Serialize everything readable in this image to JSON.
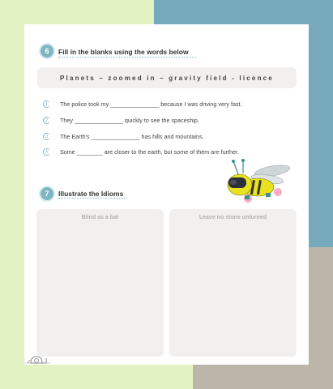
{
  "q6": {
    "number": "6",
    "title": "Fill in the blanks using the words below",
    "word_bank": "Planets – zoomed in – gravity field - licence",
    "sentences": [
      {
        "num": "1",
        "text": "The police took my _______________ because I was driving very fast."
      },
      {
        "num": "2",
        "text": "They _______________ quickly to see the spaceship."
      },
      {
        "num": "3",
        "text": "The Earth's _______________ has hills and mountains."
      },
      {
        "num": "4",
        "text": "Some ________ are closer to the earth, but some of them are further."
      }
    ]
  },
  "q7": {
    "number": "7",
    "title": "Illustrate the Idioms",
    "panels": [
      {
        "label": "Blind as a bat"
      },
      {
        "label": "Leave no stone unturned"
      }
    ]
  },
  "colors": {
    "accent": "#7fb6c4",
    "bg_green": "#e3f2c2",
    "bg_blue": "#76a9bb",
    "bg_gray": "#bcb6aa",
    "bug_yellow": "#e9e31f"
  },
  "icons": [
    "bee-robot-illustration",
    "snail-icon"
  ]
}
